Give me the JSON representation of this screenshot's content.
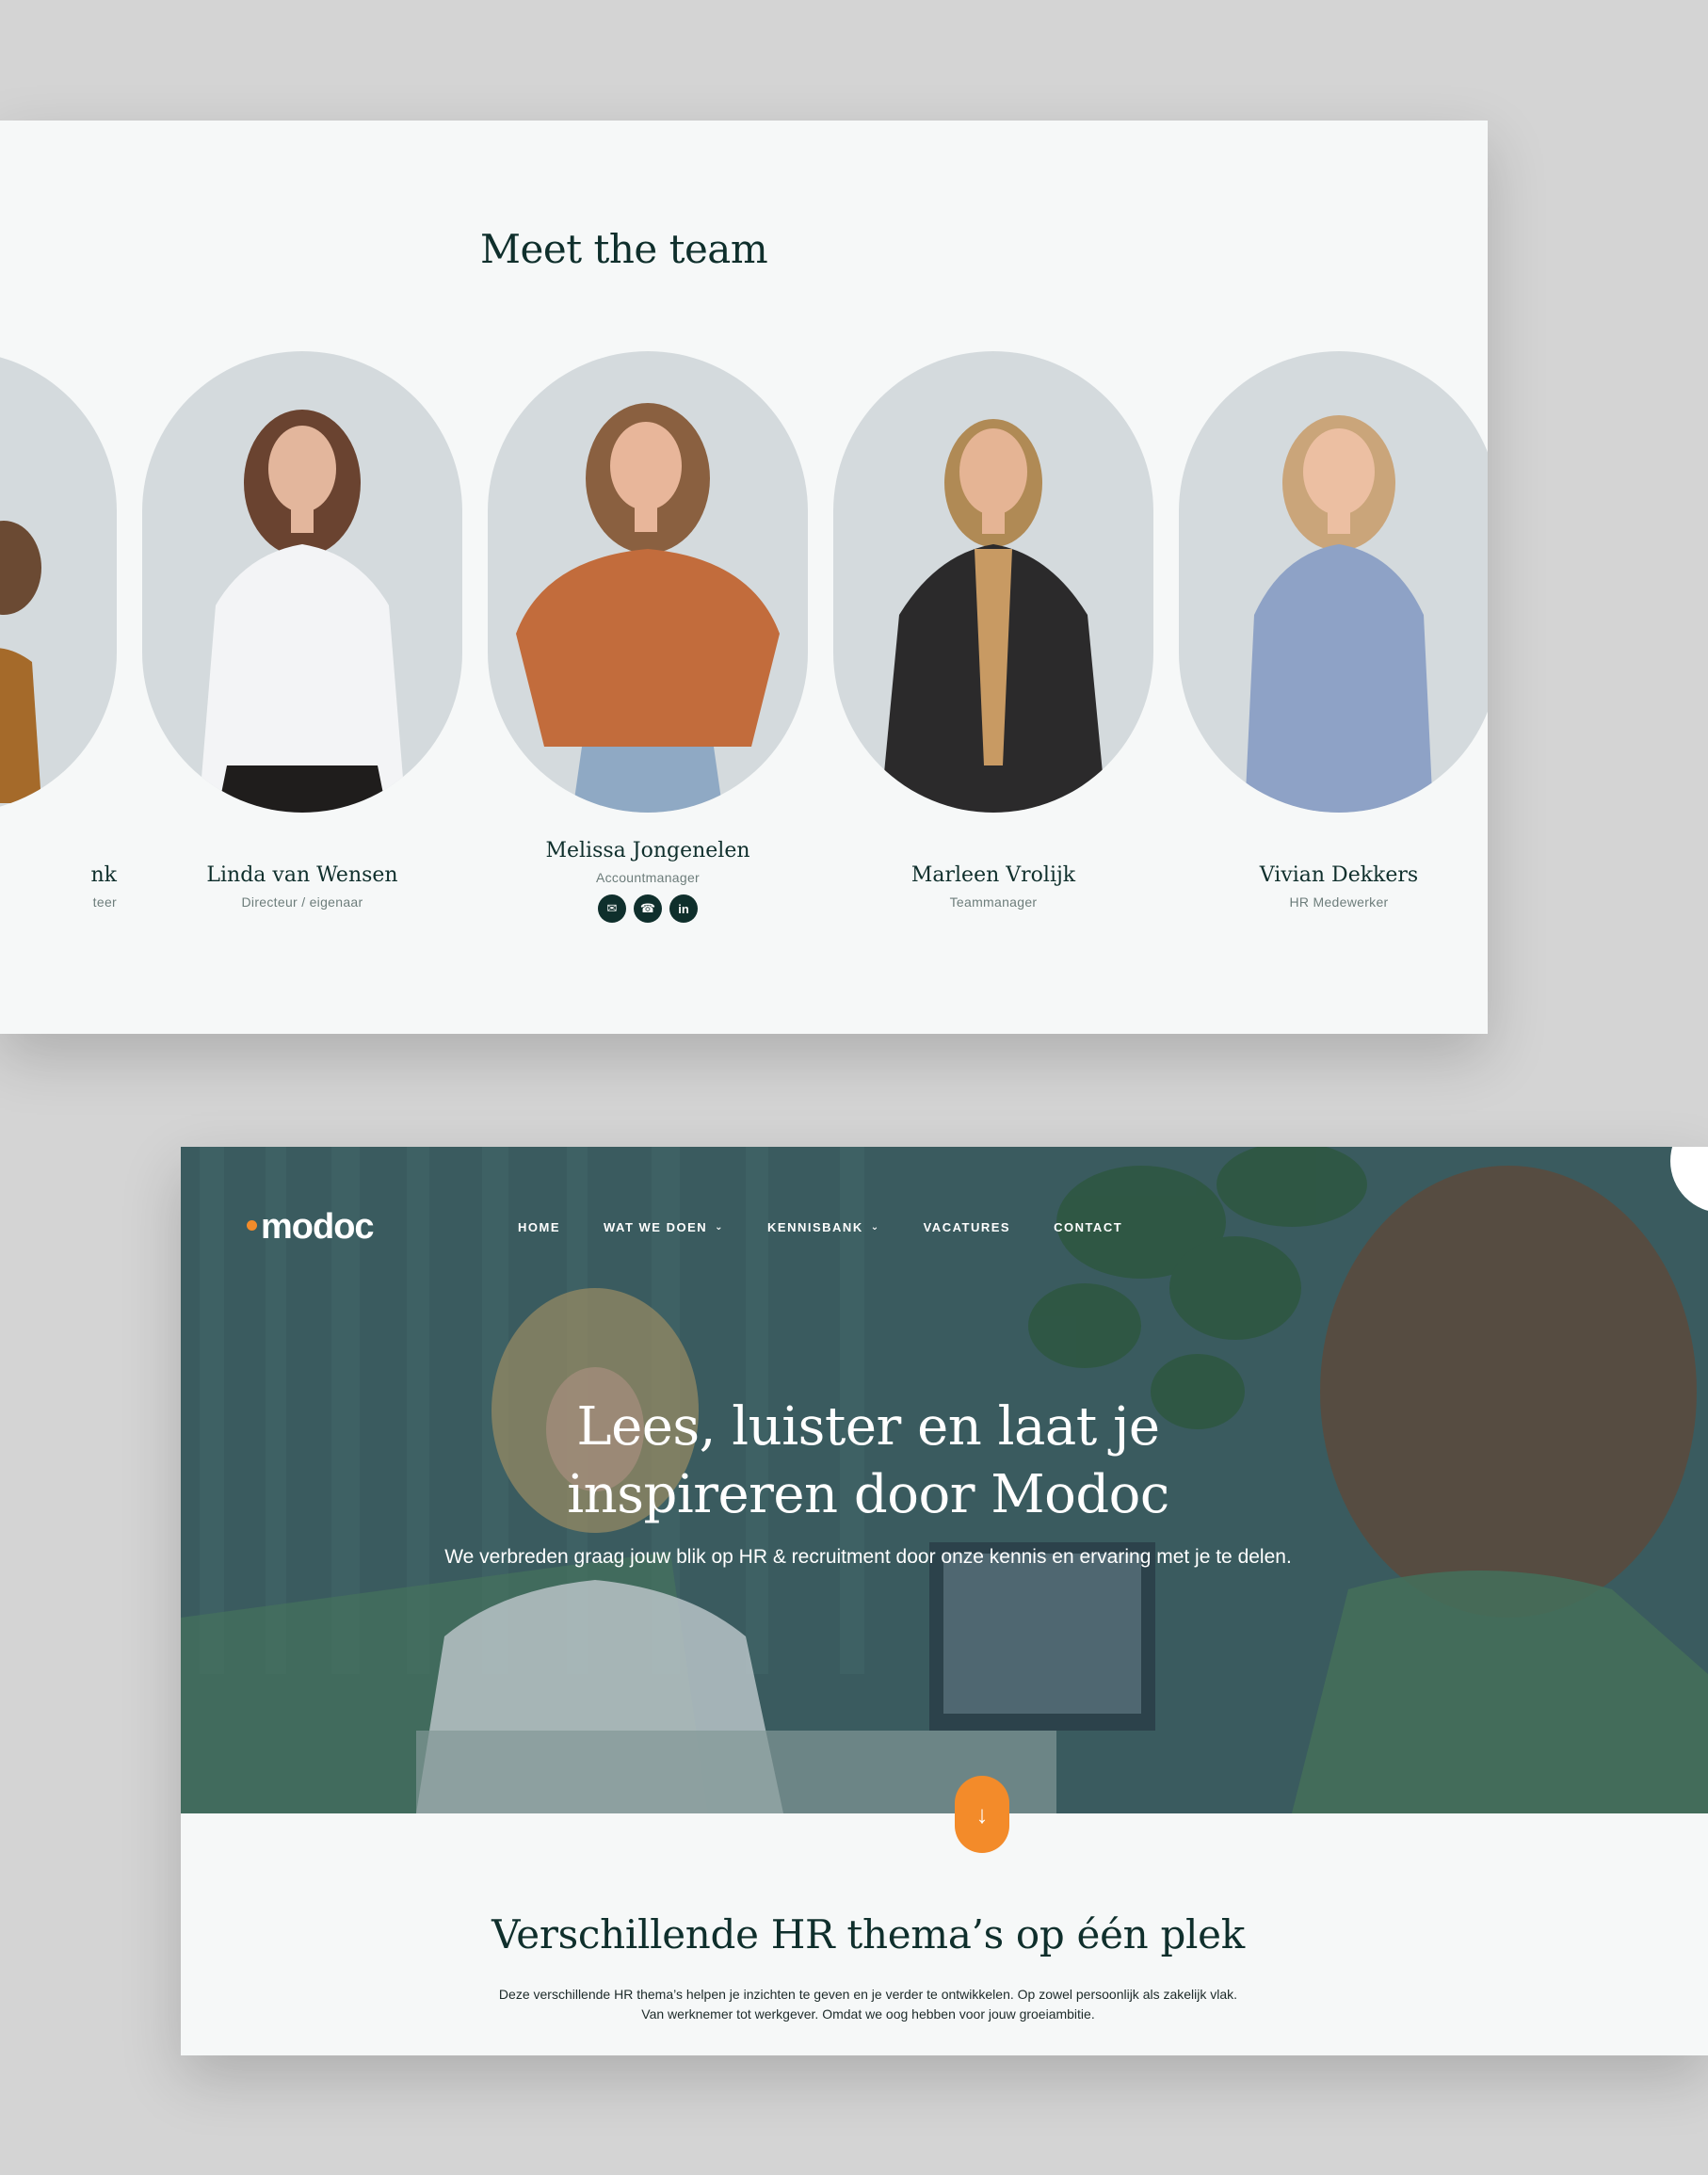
{
  "team": {
    "title": "Meet the team",
    "members": [
      {
        "name": "nk",
        "role": "teer"
      },
      {
        "name": "Linda van Wensen",
        "role": "Directeur / eigenaar"
      },
      {
        "name": "Melissa Jongenelen",
        "role": "Accountmanager",
        "icons": [
          "email-icon",
          "phone-icon",
          "linkedin-icon"
        ]
      },
      {
        "name": "Marleen Vrolijk",
        "role": "Teammanager"
      },
      {
        "name": "Vivian Dekkers",
        "role": "HR Medewerker"
      }
    ]
  },
  "site": {
    "logo": "modoc",
    "nav": [
      {
        "label": "HOME"
      },
      {
        "label": "WAT WE DOEN",
        "dropdown": true
      },
      {
        "label": "KENNISBANK",
        "dropdown": true
      },
      {
        "label": "VACATURES"
      },
      {
        "label": "CONTACT"
      }
    ],
    "hero": {
      "title_line1": "Lees, luister en laat je",
      "title_line2": "inspireren door Modoc",
      "subtitle": "We verbreden graag jouw blik op HR & recruitment door onze kennis en ervaring met je te delen."
    },
    "section": {
      "title": "Verschillende HR thema’s op één plek",
      "text_line1": "Deze verschillende HR thema’s helpen je inzichten te geven en je verder te ontwikkelen. Op zowel persoonlijk als zakelijk vlak.",
      "text_line2": "Van werknemer tot werkgever. Omdat we oog hebben voor jouw groeiambitie."
    }
  },
  "colors": {
    "accent": "#f38b2a",
    "dark": "#0f2f2c",
    "pill": "#d4dadd"
  }
}
